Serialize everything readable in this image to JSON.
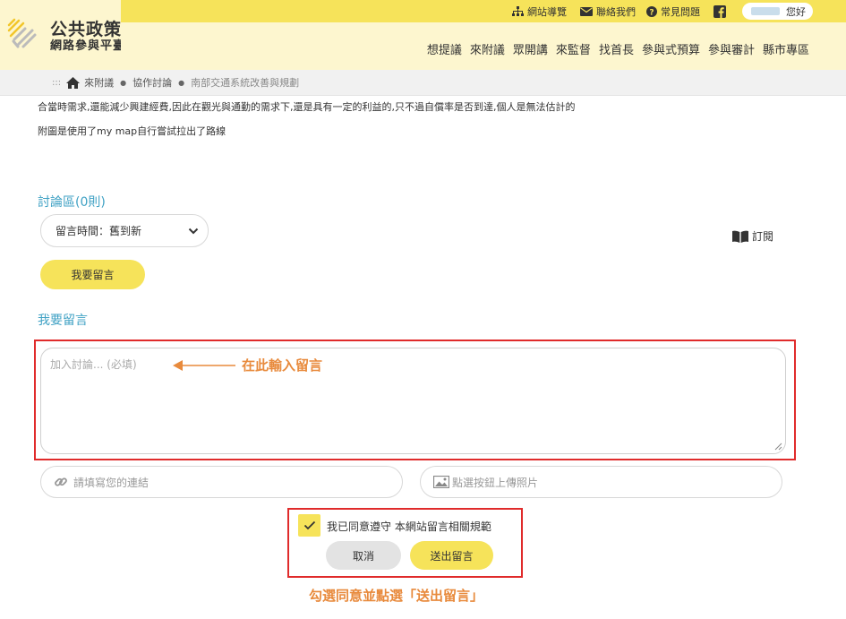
{
  "brand": {
    "title": "公共政策",
    "subtitle": "網路參與平臺"
  },
  "topbar": {
    "sitemap": "網站導覽",
    "contact": "聯絡我們",
    "faq": "常見問題",
    "greeting": "您好"
  },
  "nav": [
    "想提議",
    "來附議",
    "眾開講",
    "來監督",
    "找首長",
    "參與式預算",
    "參與審計",
    "縣市專區"
  ],
  "breadcrumb": {
    "dots": ":::",
    "items": [
      "來附議",
      "協作討論"
    ],
    "current": "南部交通系統改善與規劃"
  },
  "body_text": [
    "合當時需求,還能減少興建經費,因此在觀光與通勤的需求下,還是具有一定的利益的,只不過自償率是否到達,個人是無法估計的",
    "附圖是使用了my map自行嘗試拉出了路線"
  ],
  "discussion": {
    "heading": "討論區(0則)",
    "sort_label": "留言時間：舊到新",
    "subscribe": "訂閱",
    "leave_comment_button": "我要留言"
  },
  "comment_form": {
    "heading": "我要留言",
    "placeholder": "加入討論... (必填)",
    "link_placeholder": "請填寫您的連結",
    "photo_placeholder": "點選按鈕上傳照片",
    "agree_text": "我已同意遵守 本網站留言相關規範",
    "cancel": "取消",
    "submit": "送出留言"
  },
  "annotations": {
    "input_hint": "在此輸入留言",
    "submit_hint": "勾選同意並點選「送出留言」"
  },
  "colors": {
    "accent_yellow": "#f6e35a",
    "header_cream": "#fdf6cf",
    "heading_blue": "#3fa1c4",
    "highlight_red": "#e02b2b",
    "annotation_orange": "#e88a3c"
  }
}
